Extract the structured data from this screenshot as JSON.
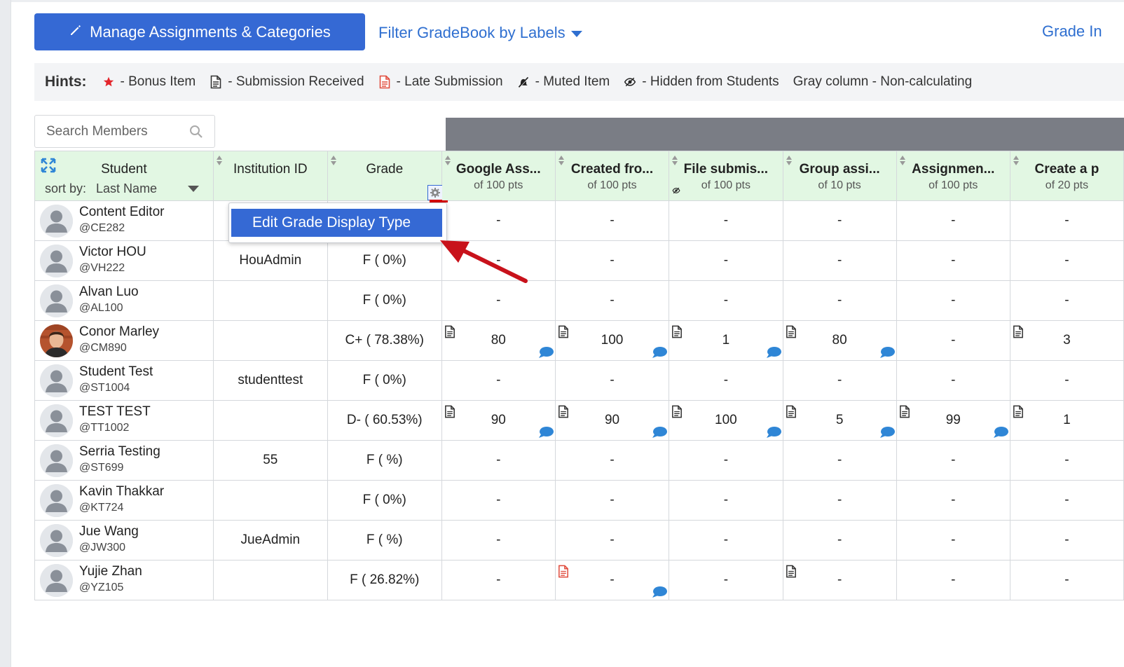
{
  "toolbar": {
    "manage_label": "Manage Assignments & Categories",
    "filter_label": "Filter GradeBook by Labels",
    "grade_link_label": "Grade In"
  },
  "hints": {
    "title": "Hints:",
    "items": [
      {
        "icon": "star-icon",
        "label": "- Bonus Item"
      },
      {
        "icon": "document-icon",
        "label": "- Submission Received"
      },
      {
        "icon": "late-document-icon",
        "label": "- Late Submission"
      },
      {
        "icon": "muted-icon",
        "label": "- Muted Item"
      },
      {
        "icon": "eye-slash-icon",
        "label": "- Hidden from Students"
      },
      {
        "icon": "",
        "label": "Gray column - Non-calculating"
      }
    ]
  },
  "search": {
    "placeholder": "Search Members"
  },
  "headers": {
    "student": "Student",
    "sort_by_label": "sort by:",
    "sort_by_value": "Last Name",
    "institution_id": "Institution ID",
    "grade": "Grade",
    "assignments": [
      {
        "title": "Google Ass...",
        "points": "of 100 pts"
      },
      {
        "title": "Created fro...",
        "points": "of 100 pts"
      },
      {
        "title": "File submis...",
        "points": "of 100 pts",
        "hidden": true
      },
      {
        "title": "Group assi...",
        "points": "of 10 pts"
      },
      {
        "title": "Assignmen...",
        "points": "of 100 pts"
      },
      {
        "title": "Create a p",
        "points": "of 20 pts"
      }
    ]
  },
  "popup": {
    "label": "Edit Grade Display Type"
  },
  "rows": [
    {
      "name": "Content Editor",
      "handle": "@CE282",
      "inst": "",
      "grade": "",
      "avatar": "default",
      "cells": [
        {
          "v": "-"
        },
        {
          "v": "-"
        },
        {
          "v": "-"
        },
        {
          "v": "-"
        },
        {
          "v": "-"
        },
        {
          "v": "-"
        }
      ]
    },
    {
      "name": "Victor HOU",
      "handle": "@VH222",
      "inst": "HouAdmin",
      "grade": "F ( 0%)",
      "avatar": "default",
      "cells": [
        {
          "v": "-"
        },
        {
          "v": "-"
        },
        {
          "v": "-"
        },
        {
          "v": "-"
        },
        {
          "v": "-"
        },
        {
          "v": "-"
        }
      ]
    },
    {
      "name": "Alvan Luo",
      "handle": "@AL100",
      "inst": "",
      "grade": "F ( 0%)",
      "avatar": "default",
      "cells": [
        {
          "v": "-"
        },
        {
          "v": "-"
        },
        {
          "v": "-"
        },
        {
          "v": "-"
        },
        {
          "v": "-"
        },
        {
          "v": "-"
        }
      ]
    },
    {
      "name": "Conor Marley",
      "handle": "@CM890",
      "inst": "",
      "grade": "C+ ( 78.38%)",
      "avatar": "photo",
      "cells": [
        {
          "v": "80",
          "doc": "normal",
          "chat": true
        },
        {
          "v": "100",
          "doc": "normal",
          "chat": true
        },
        {
          "v": "1",
          "doc": "normal",
          "chat": true
        },
        {
          "v": "80",
          "doc": "normal",
          "chat": true
        },
        {
          "v": "-"
        },
        {
          "v": "3",
          "doc": "normal"
        }
      ]
    },
    {
      "name": "Student Test",
      "handle": "@ST1004",
      "inst": "studenttest",
      "grade": "F ( 0%)",
      "avatar": "default",
      "cells": [
        {
          "v": "-"
        },
        {
          "v": "-"
        },
        {
          "v": "-"
        },
        {
          "v": "-"
        },
        {
          "v": "-"
        },
        {
          "v": "-"
        }
      ]
    },
    {
      "name": "TEST TEST",
      "handle": "@TT1002",
      "inst": "",
      "grade": "D- ( 60.53%)",
      "avatar": "default",
      "cells": [
        {
          "v": "90",
          "doc": "normal",
          "chat": true
        },
        {
          "v": "90",
          "doc": "normal",
          "chat": true
        },
        {
          "v": "100",
          "doc": "normal",
          "chat": true
        },
        {
          "v": "5",
          "doc": "normal",
          "chat": true
        },
        {
          "v": "99",
          "doc": "normal",
          "chat": true
        },
        {
          "v": "1",
          "doc": "normal"
        }
      ]
    },
    {
      "name": "Serria Testing",
      "handle": "@ST699",
      "inst": "55",
      "grade": "F ( %)",
      "avatar": "default",
      "cells": [
        {
          "v": "-"
        },
        {
          "v": "-"
        },
        {
          "v": "-"
        },
        {
          "v": "-"
        },
        {
          "v": "-"
        },
        {
          "v": "-"
        }
      ]
    },
    {
      "name": "Kavin Thakkar",
      "handle": "@KT724",
      "inst": "",
      "grade": "F ( 0%)",
      "avatar": "default",
      "cells": [
        {
          "v": "-"
        },
        {
          "v": "-"
        },
        {
          "v": "-"
        },
        {
          "v": "-"
        },
        {
          "v": "-"
        },
        {
          "v": "-"
        }
      ]
    },
    {
      "name": "Jue Wang",
      "handle": "@JW300",
      "inst": "JueAdmin",
      "grade": "F ( %)",
      "avatar": "default",
      "cells": [
        {
          "v": "-"
        },
        {
          "v": "-"
        },
        {
          "v": "-"
        },
        {
          "v": "-"
        },
        {
          "v": "-"
        },
        {
          "v": "-"
        }
      ]
    },
    {
      "name": "Yujie Zhan",
      "handle": "@YZ105",
      "inst": "",
      "grade": "F ( 26.82%)",
      "avatar": "default",
      "cells": [
        {
          "v": "-"
        },
        {
          "v": "-",
          "doc": "late",
          "chat": true
        },
        {
          "v": "-"
        },
        {
          "v": "-",
          "doc": "normal"
        },
        {
          "v": "-"
        },
        {
          "v": "-"
        }
      ]
    }
  ],
  "colors": {
    "primary": "#3569d4",
    "header_bg": "#e2f7e3",
    "link": "#2f6fd0",
    "late": "#e04b3c",
    "chat": "#2f86d6",
    "non_calc_band": "#7a7d85"
  }
}
